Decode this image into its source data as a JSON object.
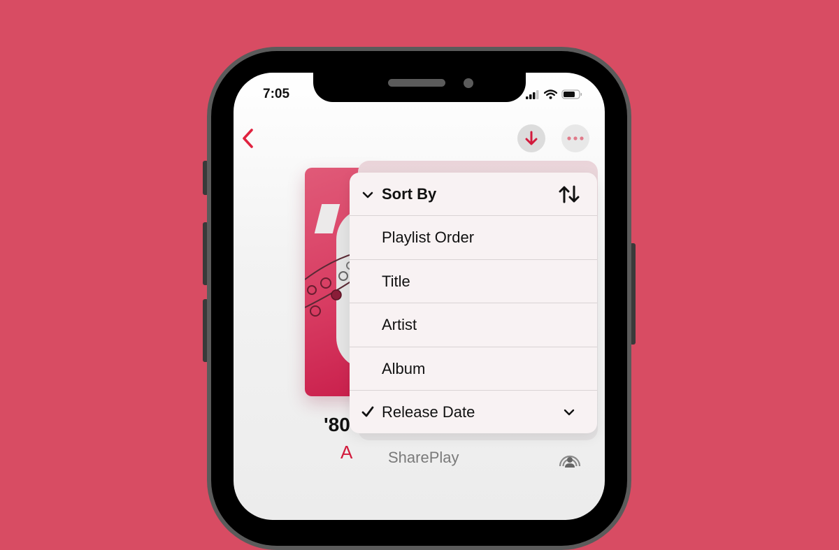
{
  "background_color": "#d84c63",
  "accent_color": "#d21a3c",
  "status_bar": {
    "time": "7:05",
    "icons": [
      "cellular-signal-icon",
      "wifi-icon",
      "battery-icon"
    ]
  },
  "nav": {
    "back_icon": "chevron-left-icon",
    "download_icon": "arrow-down-icon",
    "more_icon": "ellipsis-icon"
  },
  "playlist": {
    "title_visible": "'80",
    "subtitle_visible": "A"
  },
  "sort_menu": {
    "header": {
      "label": "Sort By",
      "lead_icon": "chevron-down-icon",
      "trail_icon": "sort-arrows-icon"
    },
    "items": [
      {
        "label": "Playlist Order",
        "checked": false
      },
      {
        "label": "Title",
        "checked": false
      },
      {
        "label": "Artist",
        "checked": false
      },
      {
        "label": "Album",
        "checked": false
      },
      {
        "label": "Release Date",
        "checked": true,
        "trail_icon": "chevron-down-icon"
      }
    ]
  },
  "background_menu": {
    "item": {
      "label": "SharePlay",
      "icon": "shareplay-icon"
    }
  }
}
